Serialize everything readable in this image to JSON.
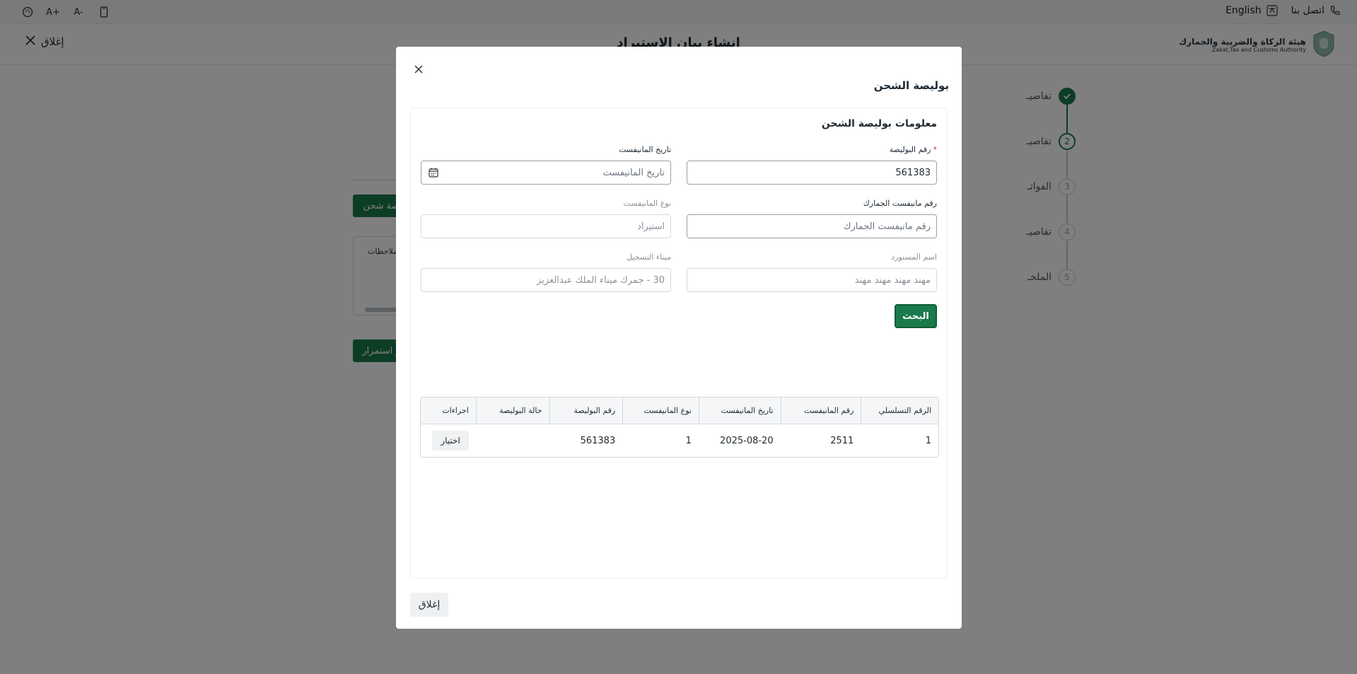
{
  "topbar": {
    "tools": [
      "palette-icon",
      "A+",
      "A-",
      "mobile-icon"
    ],
    "english_label": "English",
    "contact_label": "اتصل بنا"
  },
  "header": {
    "close_label": "إغلاق",
    "title": "انشاء بيان الاستيراد",
    "logo_ar": "هيئة الزكاة والضريبة والجمارك",
    "logo_en": "Zakat,Tax and Customs Authority"
  },
  "stepper": {
    "steps": [
      {
        "number": "",
        "label": "تفاصيـ",
        "state": "done"
      },
      {
        "number": "2",
        "label": "تفاصيـ",
        "state": "active"
      },
      {
        "number": "3",
        "label": "الفواتـ",
        "state": "pending"
      },
      {
        "number": "4",
        "label": "تفاصيـ",
        "state": "pending"
      },
      {
        "number": "5",
        "label": "الملخـ",
        "state": "pending"
      }
    ]
  },
  "background": {
    "shipping_btn": "صة شحن",
    "table_header": "ملاحظات",
    "continue_btn": "و استمرار"
  },
  "modal": {
    "title": "بوليصة الشحن",
    "card_title": "معلومات بوليصة الشحن",
    "fields": {
      "bol_number": {
        "label": "رقم البوليصة",
        "value": "561383"
      },
      "manifest_date": {
        "label": "تاريخ المانيفست",
        "placeholder": "تاريخ المانيفست"
      },
      "customs_manifest": {
        "label": "رقم مانيفست الجمارك",
        "placeholder": "رقم مانيفست الجمارك"
      },
      "manifest_type": {
        "label": "نوع المانيفست",
        "value": "استيراد"
      },
      "importer_name": {
        "label": "اسم المستورد",
        "value": "مهند مهند مهند مهند"
      },
      "registration_port": {
        "label": "ميناء التسجيل",
        "value": "30 - جمرك ميناء الملك عبدالعزيز"
      }
    },
    "search_label": "البحث",
    "table": {
      "headers": [
        "الرقم التسلسلي",
        "رقم المانيفست",
        "تاريخ المانيفست",
        "نوع المانيفست",
        "رقم البوليصة",
        "حالة البوليصة",
        "اجراءات"
      ],
      "rows": [
        {
          "serial": "1",
          "manifest_no": "2511",
          "manifest_date": "2025-08-20",
          "manifest_type": "1",
          "bol_no": "561383",
          "bol_status": "",
          "action": "اختيار"
        }
      ]
    },
    "close_label": "إغلاق"
  }
}
